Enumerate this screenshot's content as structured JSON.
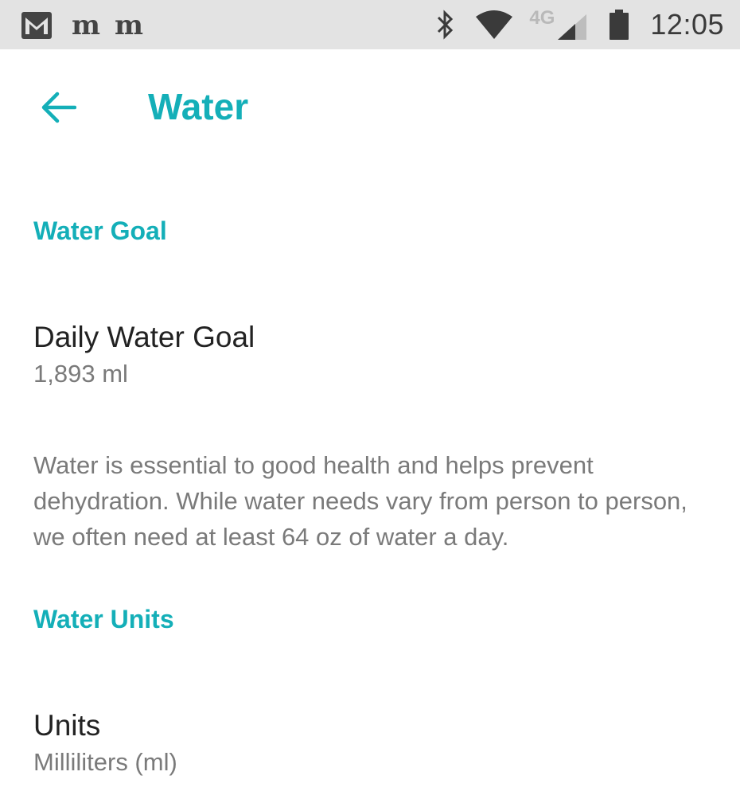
{
  "status_bar": {
    "left_icons": [
      "gmail-icon",
      "nyt-icon",
      "nyt-icon"
    ],
    "nyt_glyph": "m",
    "network_label": "4G",
    "time": "12:05"
  },
  "app_bar": {
    "title": "Water",
    "back_icon": "arrow-left-icon"
  },
  "sections": {
    "goal": {
      "header": "Water Goal",
      "daily_goal": {
        "title": "Daily Water Goal",
        "value": "1,893 ml"
      },
      "info": "Water is essential to good health and helps prevent dehydration. While water needs vary from person to person, we often need at least 64 oz of water a day."
    },
    "units": {
      "header": "Water Units",
      "units_item": {
        "title": "Units",
        "value": "Milliliters (ml)"
      }
    }
  },
  "colors": {
    "accent": "#14afb8",
    "status_bar_bg": "#e3e3e3",
    "primary_text": "#222222",
    "secondary_text": "#7a7a7a"
  }
}
